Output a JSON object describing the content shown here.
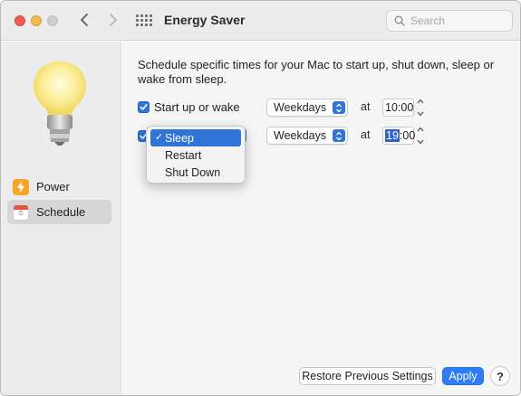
{
  "window": {
    "title": "Energy Saver",
    "search_placeholder": "Search"
  },
  "sidebar": {
    "items": [
      {
        "label": "Power",
        "icon": "lightning-bolt-icon",
        "selected": false
      },
      {
        "label": "Schedule",
        "icon": "calendar-icon",
        "selected": true
      }
    ]
  },
  "schedule": {
    "description": "Schedule specific times for your Mac to start up, shut down, sleep or wake from sleep.",
    "rows": [
      {
        "checked": true,
        "label": "Start up or wake",
        "frequency": "Weekdays",
        "at_label": "at",
        "time_hour": "10",
        "time_sep": ":",
        "time_minute": "00"
      },
      {
        "checked": true,
        "label": "Sleep",
        "frequency": "Weekdays",
        "at_label": "at",
        "time_hour": "19",
        "time_sep": ":",
        "time_minute": "00"
      }
    ],
    "action_menu": {
      "options": [
        "Sleep",
        "Restart",
        "Shut Down"
      ],
      "selected": "Sleep"
    }
  },
  "footer": {
    "restore_label": "Restore Previous Settings",
    "apply_label": "Apply",
    "help_label": "?"
  },
  "colors": {
    "accent": "#2f74d6",
    "apply_button": "#2f7cf6",
    "close": "#ee5c53",
    "minimize": "#f4bd4f",
    "power_icon_bg": "#f5a623",
    "schedule_icon_bg": "#e8503f"
  }
}
